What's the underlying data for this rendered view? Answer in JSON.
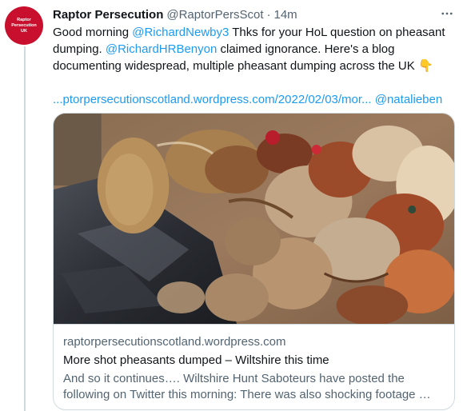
{
  "tweet": {
    "avatar_lines": [
      "Raptor",
      "Persecution",
      "UK"
    ],
    "author_name": "Raptor Persecution",
    "author_handle": "@RaptorPersScot",
    "separator": "·",
    "time": "14m",
    "text_part1": "Good morning ",
    "mention1": "@RichardNewby3",
    "text_part2": " Thks for your HoL question on pheasant dumping. ",
    "mention2": "@RichardHRBenyon",
    "text_part3": " claimed ignorance. Here's a blog documenting widespread, multiple pheasant dumping across the UK ",
    "emoji": "👇",
    "link_url": "...ptorpersecutionscotland.wordpress.com/2022/02/03/mor...",
    "mention3": "@natalieben"
  },
  "card": {
    "domain": "raptorpersecutionscotland.wordpress.com",
    "title": "More shot pheasants dumped – Wiltshire this time",
    "description": "And so it continues…. Wiltshire Hunt Saboteurs have posted the following on Twitter this morning: There was also shocking footage …"
  },
  "icons": {
    "more": "more-horizontal-icon"
  },
  "colors": {
    "link": "#1d9bf0",
    "avatar_bg": "#c8102e",
    "muted": "#536471"
  }
}
